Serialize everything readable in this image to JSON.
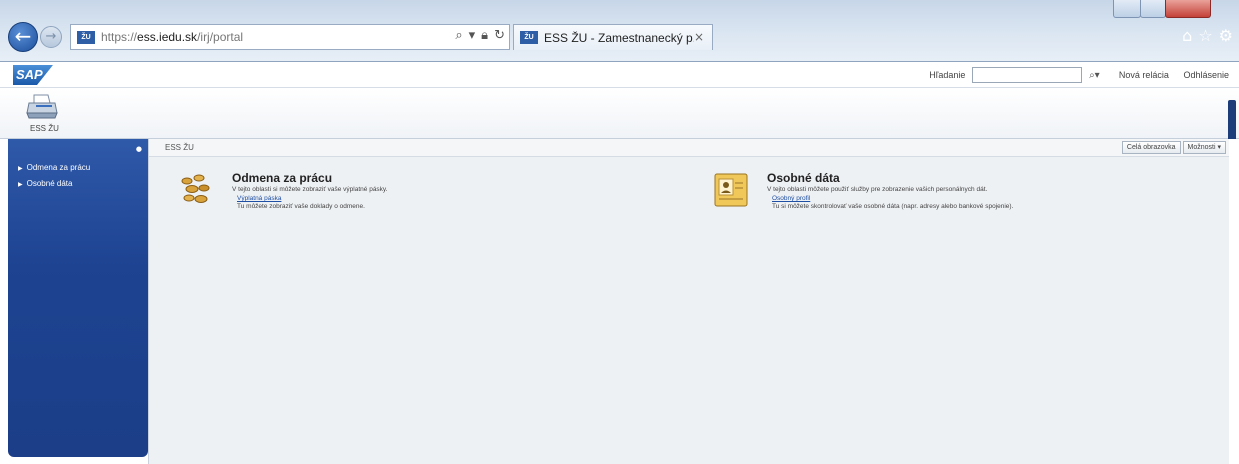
{
  "browser": {
    "url_prefix": "https://",
    "url_domain": "ess.iedu.sk",
    "url_path": "/irj/portal",
    "tab_title": "ESS ŽU - Zamestnanecký p...",
    "tab_close": "×",
    "fav_label": "ŽU"
  },
  "header": {
    "logo": "SAP",
    "search_label": "Hľadanie",
    "search_value": "",
    "search_icon": "search-icon",
    "links": [
      "Nová relácia",
      "Odhlásenie"
    ]
  },
  "workset": {
    "label": "ESS ŽU"
  },
  "leftnav": {
    "items": [
      {
        "label": "Odmena za prácu"
      },
      {
        "label": "Osobné dáta"
      }
    ]
  },
  "content": {
    "title": "ESS ŽU",
    "buttons": [
      "Celá obrazovka",
      "Možnosti ▾"
    ],
    "sections": [
      {
        "title": "Odmena za prácu",
        "description": "V tejto oblasti si môžete zobraziť vaše výplatné pásky.",
        "link": "Výplatná páska",
        "link_description": "Tu môžete zobraziť vaše doklady o odmene."
      },
      {
        "title": "Osobné dáta",
        "description": "V tejto oblasti môžete použiť služby pre zobrazenie vašich personálnych dát.",
        "link": "Osobný profil",
        "link_description": "Tu si môžete skontrolovať vaše osobné dáta (napr. adresy alebo bankové spojenie)."
      }
    ]
  },
  "colors": {
    "nav_blue": "#1d4391",
    "link_blue": "#1f4fa3",
    "content_bg": "#eef1f4"
  }
}
